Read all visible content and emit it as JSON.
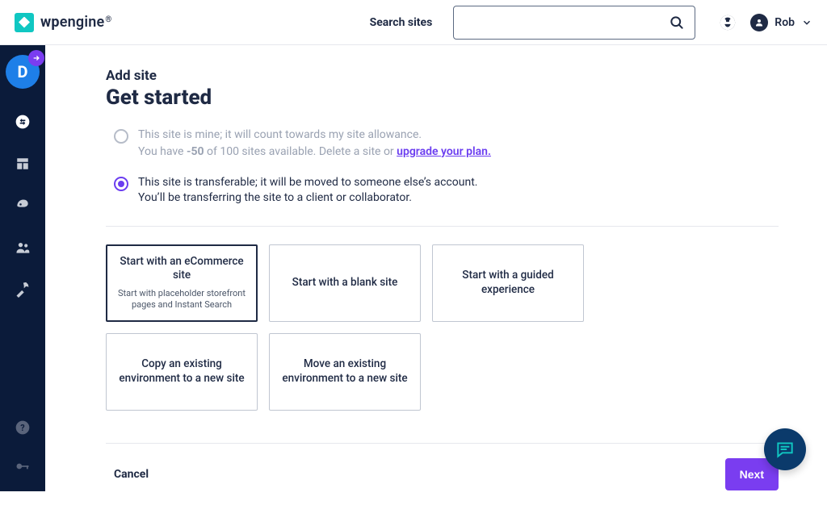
{
  "brand": {
    "name_a": "wp",
    "name_b": "engine",
    "trademark": "®"
  },
  "header": {
    "search_label": "Search sites",
    "search_placeholder": "",
    "user_name": "Rob"
  },
  "rail": {
    "bubble_letter": "D"
  },
  "page": {
    "breadcrumb": "Add site",
    "title": "Get started"
  },
  "ownership": {
    "mine": {
      "line1": "This site is mine; it will count towards my site allowance.",
      "line2_pre": "You have ",
      "count": "-50",
      "line2_mid": " of 100 sites available. Delete a site or ",
      "upgrade_link": "upgrade your plan.",
      "selected": false,
      "disabled": true
    },
    "transferable": {
      "line1": "This site is transferable; it will be moved to someone else’s account.",
      "line2": "You’ll be transferring the site to a client or collaborator.",
      "selected": true
    }
  },
  "tiles": [
    {
      "title": "Start with an eCommerce site",
      "sub": "Start with placeholder storefront pages and Instant Search",
      "selected": true
    },
    {
      "title": "Start with a blank site",
      "sub": "",
      "selected": false
    },
    {
      "title": "Start with a guided experience",
      "sub": "",
      "selected": false
    },
    {
      "title": "Copy an existing environment to a new site",
      "sub": "",
      "selected": false
    },
    {
      "title": "Move an existing environment to a new site",
      "sub": "",
      "selected": false
    }
  ],
  "footer": {
    "cancel": "Cancel",
    "next": "Next"
  }
}
